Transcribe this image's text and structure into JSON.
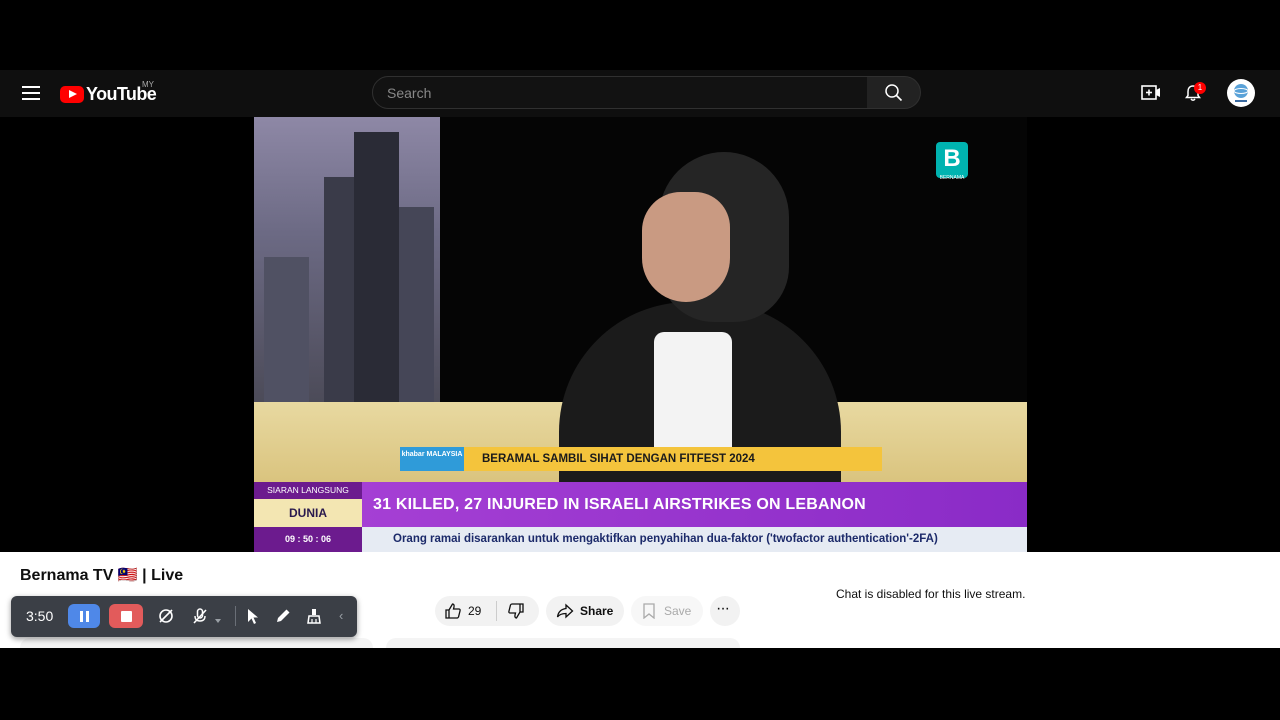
{
  "header": {
    "logo_text": "YouTube",
    "country_code": "MY",
    "search_placeholder": "Search",
    "notification_count": "1"
  },
  "video": {
    "channel_logo_text": "B",
    "channel_logo_sub": "BERNAMA",
    "program_logo": "khabar MALAYSIA",
    "segment_headline": "BERAMAL SAMBIL SIHAT DENGAN FITFEST 2024",
    "live_label": "SIARAN LANGSUNG",
    "section_label": "DUNIA",
    "clock": "09 : 50 : 06",
    "breaking_headline": "31 KILLED, 27 INJURED IN ISRAELI AIRSTRIKES ON LEBANON",
    "ticker": "Orang ramai disarankan untuk mengaktifkan penyahihan dua-faktor ('twofactor authentication'-2FA)"
  },
  "details": {
    "title": "Bernama TV 🇲🇾 | Live",
    "like_count": "29",
    "share_label": "Share",
    "save_label": "Save",
    "more_label": "···",
    "chat_message": "Chat is disabled for this live stream."
  },
  "recorder": {
    "elapsed": "3:50",
    "chevron": "‹"
  },
  "colors": {
    "youtube_red": "#ff0000",
    "breaking_purple": "#8a2bc7",
    "headline_yellow": "#f4c43c",
    "recorder_pause": "#4f88e8",
    "recorder_stop": "#e25b5b"
  }
}
